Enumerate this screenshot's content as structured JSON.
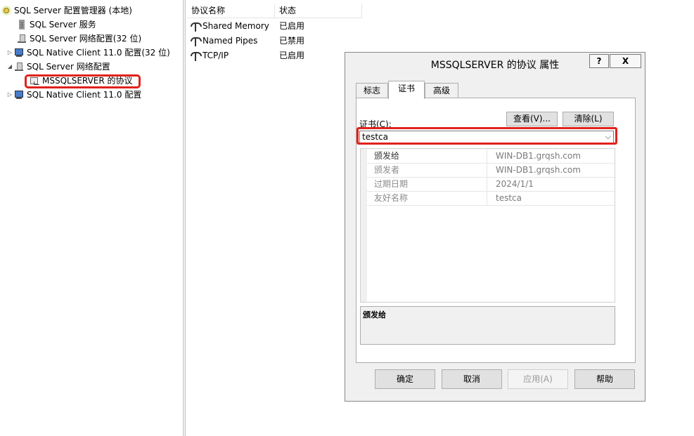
{
  "tree": {
    "root": "SQL Server 配置管理器 (本地)",
    "items": [
      {
        "label": "SQL Server 服务"
      },
      {
        "label": "SQL Server 网络配置(32 位)"
      },
      {
        "label": "SQL Native Client 11.0 配置(32 位)"
      },
      {
        "label": "SQL Server 网络配置"
      },
      {
        "label": "MSSQLSERVER 的协议"
      },
      {
        "label": "SQL Native Client 11.0 配置"
      }
    ]
  },
  "list": {
    "columns": [
      "协议名称",
      "状态"
    ],
    "rows": [
      {
        "name": "Shared Memory",
        "status": "已启用"
      },
      {
        "name": "Named Pipes",
        "status": "已禁用"
      },
      {
        "name": "TCP/IP",
        "status": "已启用"
      }
    ]
  },
  "dialog": {
    "title": "MSSQLSERVER 的协议 属性",
    "help_btn": "?",
    "close_btn": "X",
    "tabs": [
      "标志",
      "证书",
      "高级"
    ],
    "cert_label": "证书(C):",
    "view_btn": "查看(V)...",
    "clear_btn": "清除(L)",
    "cert_value": "testca",
    "grid": [
      {
        "key": "颁发给",
        "value": "WIN-DB1.grqsh.com"
      },
      {
        "key": "颁发者",
        "value": "WIN-DB1.grqsh.com"
      },
      {
        "key": "过期日期",
        "value": "2024/1/1"
      },
      {
        "key": "友好名称",
        "value": "testca"
      }
    ],
    "desc_title": "颁发给",
    "buttons": {
      "ok": "确定",
      "cancel": "取消",
      "apply": "应用(A)",
      "help": "帮助"
    }
  },
  "colors": {
    "highlight": "#e0221c"
  }
}
